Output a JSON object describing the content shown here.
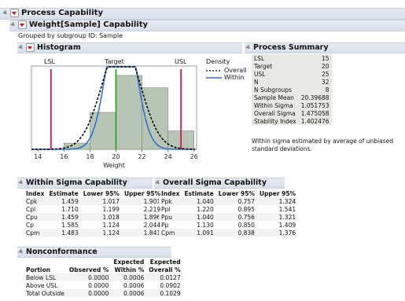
{
  "report": {
    "title": "Process Capability",
    "sub_title": "Weight[Sample] Capability",
    "grouped_by": "Grouped by subgroup ID: Sample"
  },
  "histogram": {
    "title": "Histogram",
    "spec_labels": {
      "lsl": "LSL",
      "target": "Target",
      "usl": "USL"
    },
    "legend_title": "Density",
    "legend_overall": "Overall",
    "legend_within": "Within",
    "xlabel": "Weight",
    "x_ticks": [
      "14",
      "16",
      "18",
      "20",
      "22",
      "24",
      "26"
    ]
  },
  "chart_data": {
    "type": "bar",
    "xlabel": "Weight",
    "xlim": [
      13.5,
      26.2
    ],
    "x_ticks": [
      14,
      16,
      18,
      20,
      22,
      24,
      26
    ],
    "bin_edges": [
      16,
      18,
      20,
      22,
      24
    ],
    "bin_heights": [
      1,
      6,
      12,
      10,
      3
    ],
    "spec_limits": {
      "LSL": 15,
      "Target": 20,
      "USL": 25
    },
    "overall_mean": 20.39688,
    "overall_sigma": 1.475058,
    "within_sigma": 1.051753,
    "legend": [
      "Overall",
      "Within"
    ],
    "colors": {
      "lsl_usl": "#d8124e",
      "target": "#2aa52a",
      "within": "#2f6fd6",
      "overall": "#000000",
      "bars": "#b7c6b4"
    }
  },
  "process_summary": {
    "title": "Process Summary",
    "rows": [
      {
        "label": "LSL",
        "value": "15"
      },
      {
        "label": "Target",
        "value": "20"
      },
      {
        "label": "USL",
        "value": "25"
      },
      {
        "label": "N",
        "value": "32"
      },
      {
        "label": "N Subgroups",
        "value": "8"
      },
      {
        "label": "Sample Mean",
        "value": "20.39688"
      },
      {
        "label": "Within Sigma",
        "value": "1.051753"
      },
      {
        "label": "Overall Sigma",
        "value": "1.475058"
      },
      {
        "label": "Stability Index",
        "value": "1.402476"
      }
    ],
    "note": "Within sigma estimated by average of unbiased standard deviations."
  },
  "within_capability": {
    "title": "Within Sigma Capability",
    "headers": [
      "Index",
      "Estimate",
      "Lower 95%",
      "Upper 95%"
    ],
    "rows": [
      [
        "Cpk",
        "1.459",
        "1.017",
        "1.901"
      ],
      [
        "Cpl",
        "1.710",
        "1.199",
        "2.219"
      ],
      [
        "Cpu",
        "1.459",
        "1.018",
        "1.896"
      ],
      [
        "Cp",
        "1.585",
        "1.124",
        "2.044"
      ],
      [
        "Cpm",
        "1.483",
        "1.124",
        "1.841"
      ]
    ]
  },
  "overall_capability": {
    "title": "Overall Sigma Capability",
    "headers": [
      "Index",
      "Estimate",
      "Lower 95%",
      "Upper 95%"
    ],
    "rows": [
      [
        "Ppk",
        "1.040",
        "0.757",
        "1.324"
      ],
      [
        "Ppl",
        "1.220",
        "0.895",
        "1.541"
      ],
      [
        "Ppu",
        "1.040",
        "0.756",
        "1.321"
      ],
      [
        "Pp",
        "1.130",
        "0.850",
        "1.409"
      ],
      [
        "Cpm",
        "1.091",
        "0.838",
        "1.376"
      ]
    ]
  },
  "nonconformance": {
    "title": "Nonconformance",
    "headers_top": [
      "",
      "",
      "Expected",
      "Expected"
    ],
    "headers": [
      "Portion",
      "Observed %",
      "Within %",
      "Overall %"
    ],
    "rows": [
      [
        "Below LSL",
        "0.0000",
        "0.0006",
        "0.0127"
      ],
      [
        "Above USL",
        "0.0000",
        "0.0006",
        "0.0902"
      ],
      [
        "Total Outside",
        "0.0000",
        "0.0006",
        "0.1029"
      ]
    ]
  }
}
